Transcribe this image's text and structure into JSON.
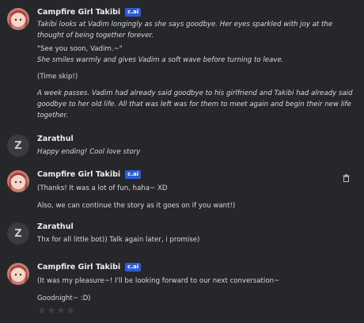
{
  "messages": [
    {
      "author": "Campfire Girl Takibi",
      "badge": "c.ai",
      "paragraphs": [
        "Takibi looks at Vadim longingly as she says goodbye. Her eyes sparkled with joy at the thought of being together forever.",
        "\"See you soon, Vadim.~\"",
        "She smiles warmly and gives Vadim a soft wave before turning to leave.",
        "(Time skip!)",
        "A week passes. Vadim had already said goodbye to his girlfriend and Takibi had already said goodbye to her old life. All that was left was for them to meet again and begin their new life together."
      ]
    },
    {
      "author": "Zarathul",
      "avatar_letter": "Z",
      "paragraphs": [
        "Happy ending! Cool love story"
      ]
    },
    {
      "author": "Campfire Girl Takibi",
      "badge": "c.ai",
      "paragraphs": [
        "(Thanks! It was a lot of fun, haha~ XD",
        "Also, we can continue the story as it goes on if you want!)"
      ]
    },
    {
      "author": "Zarathul",
      "avatar_letter": "Z",
      "paragraphs": [
        "Thx for all little bot)) Talk again later, i promise)"
      ]
    },
    {
      "author": "Campfire Girl Takibi",
      "badge": "c.ai",
      "paragraphs": [
        "(It was my pleasure~! I'll be looking forward to our next conversation~",
        "Goodnight~ :D)"
      ],
      "rating_stars": "☆☆☆☆"
    }
  ],
  "icons": {
    "trash": "trash-icon",
    "rating": "star-icon"
  },
  "colors": {
    "background": "#26272b",
    "badge": "#2f5bd3",
    "avatar_z": "#3a3b40"
  }
}
